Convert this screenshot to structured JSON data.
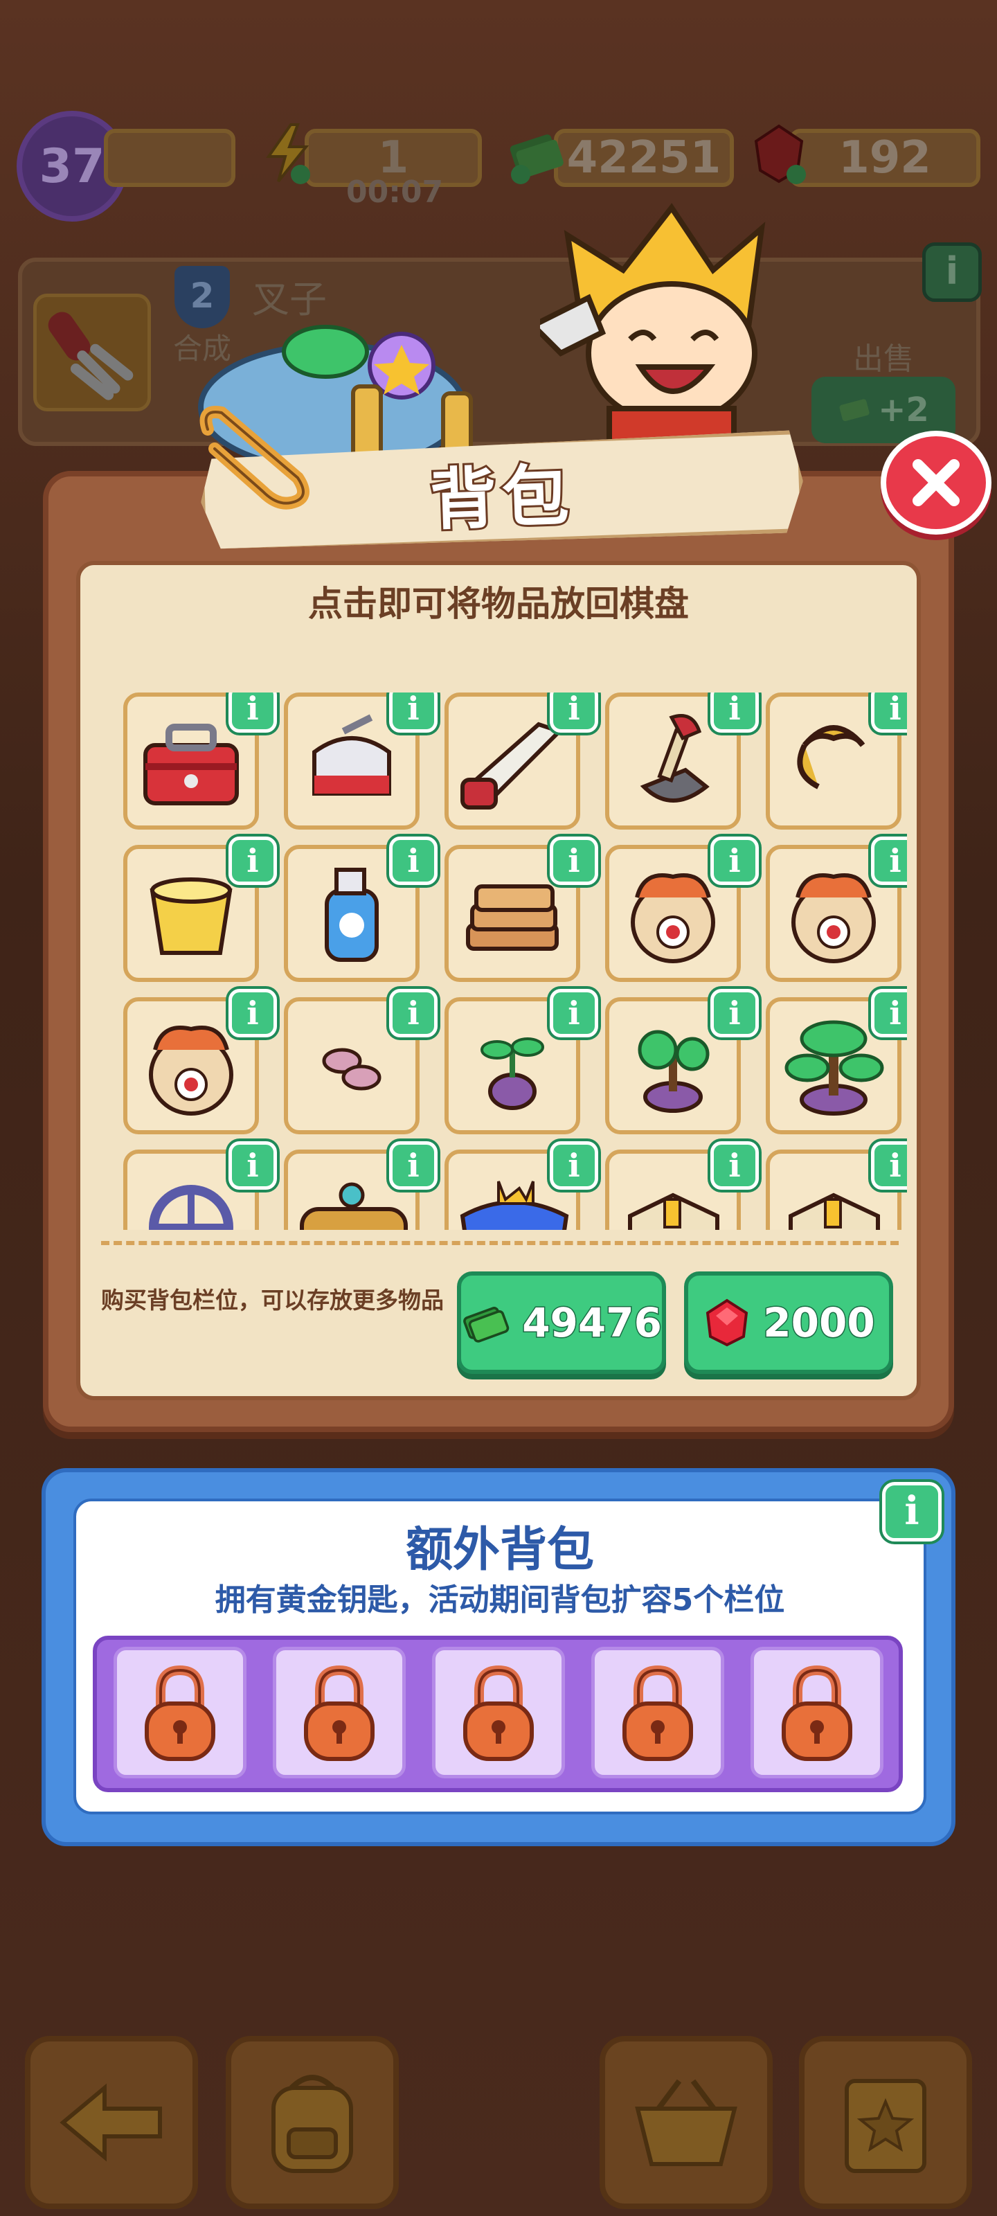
{
  "hud": {
    "level": "37",
    "energy": "1",
    "energy_timer": "00:07",
    "cash": "42251",
    "gems": "192"
  },
  "info_panel": {
    "item_level": "2",
    "item_name": "叉子",
    "item_desc": "合成",
    "sell_label": "出售",
    "sell_value": "+2",
    "info_symbol": "i"
  },
  "dialog": {
    "title": "背包",
    "hint": "点击即可将物品放回棋盘",
    "buy_text": "购买背包栏位，可以存放更多物品",
    "buy_cash_price": "49476",
    "buy_gem_price": "2000",
    "info_symbol": "i"
  },
  "items": [
    {
      "name": "toolbox"
    },
    {
      "name": "red-kettle"
    },
    {
      "name": "saw"
    },
    {
      "name": "plunger-shovel"
    },
    {
      "name": "gold-horseshoe"
    },
    {
      "name": "yellow-bucket"
    },
    {
      "name": "spray-bottle"
    },
    {
      "name": "cardboard-stack"
    },
    {
      "name": "dragon-vase"
    },
    {
      "name": "dragon-vase"
    },
    {
      "name": "dragon-vase"
    },
    {
      "name": "seeds"
    },
    {
      "name": "sprout"
    },
    {
      "name": "small-tree"
    },
    {
      "name": "bonsai-tree"
    },
    {
      "name": "valve-wheel"
    },
    {
      "name": "brass-telescope"
    },
    {
      "name": "royal-pillow"
    },
    {
      "name": "wrapped-box"
    },
    {
      "name": "wrapped-box"
    }
  ],
  "extra_backpack": {
    "title": "额外背包",
    "subtitle": "拥有黄金钥匙，活动期间背包扩容5个栏位",
    "locked_slots": 5,
    "info_symbol": "i"
  },
  "colors": {
    "dialog_brown": "#9b5e3e",
    "panel_cream": "#f2e3c4",
    "green_button": "#3ecb80",
    "close_red": "#e8394a",
    "extra_blue": "#4a8ee0",
    "lock_purple": "#9f6ae0"
  },
  "bottom_nav": [
    {
      "icon": "back-arrow-icon"
    },
    {
      "icon": "backpack-icon"
    },
    {
      "icon": "basket-icon"
    },
    {
      "icon": "clipboard-star-icon"
    }
  ]
}
